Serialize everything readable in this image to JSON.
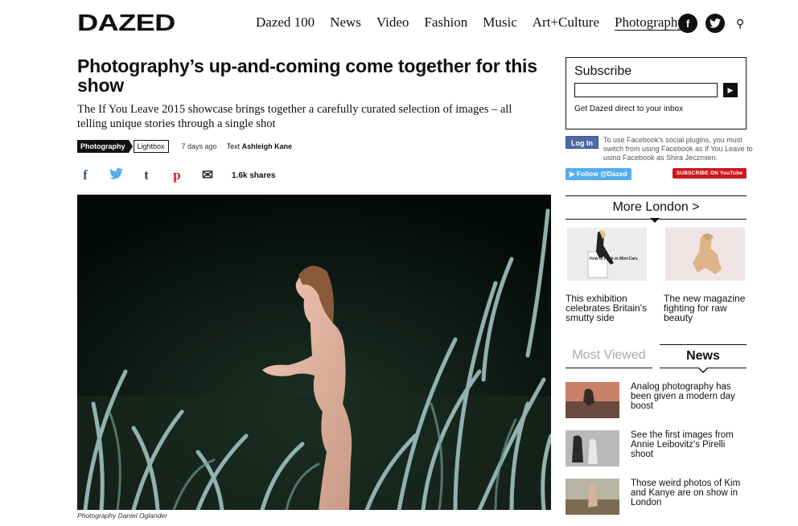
{
  "header": {
    "logo": "DAZED",
    "nav": [
      "Dazed 100",
      "News",
      "Video",
      "Fashion",
      "Music",
      "Art+Culture",
      "Photography"
    ],
    "active_nav": "Photography",
    "facebook_icon": "f",
    "twitter_icon": "t",
    "search_icon": "⚲"
  },
  "article": {
    "headline": "Photography’s up-and-coming come together for this show",
    "standfirst": "The If You Leave 2015 showcase brings together a carefully curated selection of images – all telling unique stories through a single shot",
    "tag_primary": "Photography",
    "tag_secondary": "Lightbox",
    "date": "7 days ago",
    "text_label": "Text",
    "author": "Ashleigh Kane",
    "share_icons": [
      "f",
      "t",
      "t",
      "p",
      "✉"
    ],
    "shares": "1.6k shares",
    "caption": "Photography Daniel Oglander"
  },
  "sidebar": {
    "subscribe": {
      "title": "Subscribe",
      "button": "▶",
      "note": "Get Dazed direct to your inbox"
    },
    "facebook": {
      "login": "Log In",
      "text": "To use Facebook's social plugins, you must switch from using Facebook as If You Leave to using Facebook as Shira Jeczmien."
    },
    "follow": "Follow @Dazed",
    "youtube": "SUBSCRIBE ON YouTube",
    "more_london": {
      "title": "More London >",
      "items": [
        {
          "title": "This exhibition celebrates Britain's smutty side",
          "thumb_text": "How to Fuck in Mini-Cars"
        },
        {
          "title": "The new magazine fighting for raw beauty"
        }
      ]
    },
    "tabs": {
      "most_viewed": "Most Viewed",
      "news": "News"
    },
    "news": [
      {
        "title": "Analog photography has been given a modern day boost"
      },
      {
        "title": "See the first images from Annie Leibovitz's Pirelli shoot"
      },
      {
        "title": "Those weird photos of Kim and Kanye are on show in London"
      }
    ]
  },
  "colors": {
    "facebook": "#3b5998",
    "twitter": "#55acee",
    "pinterest": "#cb2027",
    "youtube": "#cc181e"
  }
}
